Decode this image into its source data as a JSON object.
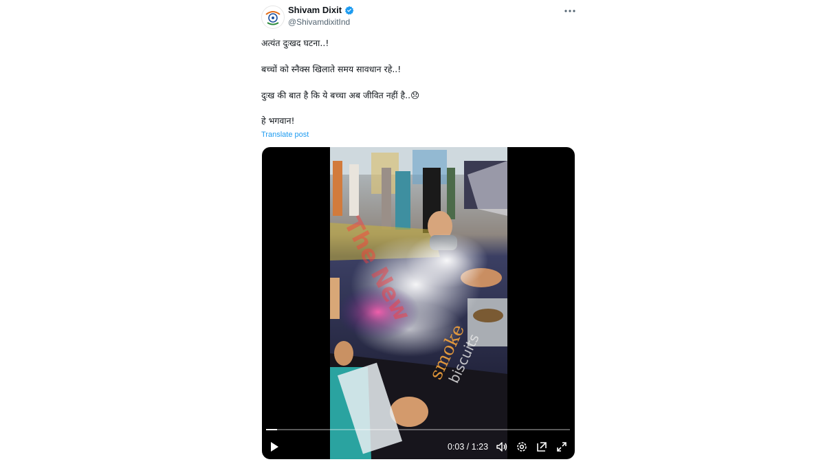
{
  "author": {
    "name": "Shivam Dixit",
    "handle": "@ShivamdixitInd",
    "verified": true
  },
  "menu_icon": "more-horizontal-icon",
  "post": {
    "lines": [
      "अत्यंत दुःखद घटना..!",
      "बच्चों को स्नैक्स खिलाते समय सावधान रहे..!",
      "दुःख की बात है कि ये बच्चा अब जीवित नहीं है..😞",
      "हे भगवान!"
    ],
    "translate_label": "Translate post"
  },
  "video": {
    "time_display": "0:03 / 1:23",
    "progress_fraction": 0.036,
    "watermark": "The New",
    "controls": [
      "play-icon",
      "volume-icon",
      "settings-icon",
      "picture-in-picture-icon",
      "fullscreen-icon"
    ]
  },
  "colors": {
    "link": "#1d9bf0",
    "verified_badge": "#1d9bf0",
    "secondary_text": "#536471"
  }
}
